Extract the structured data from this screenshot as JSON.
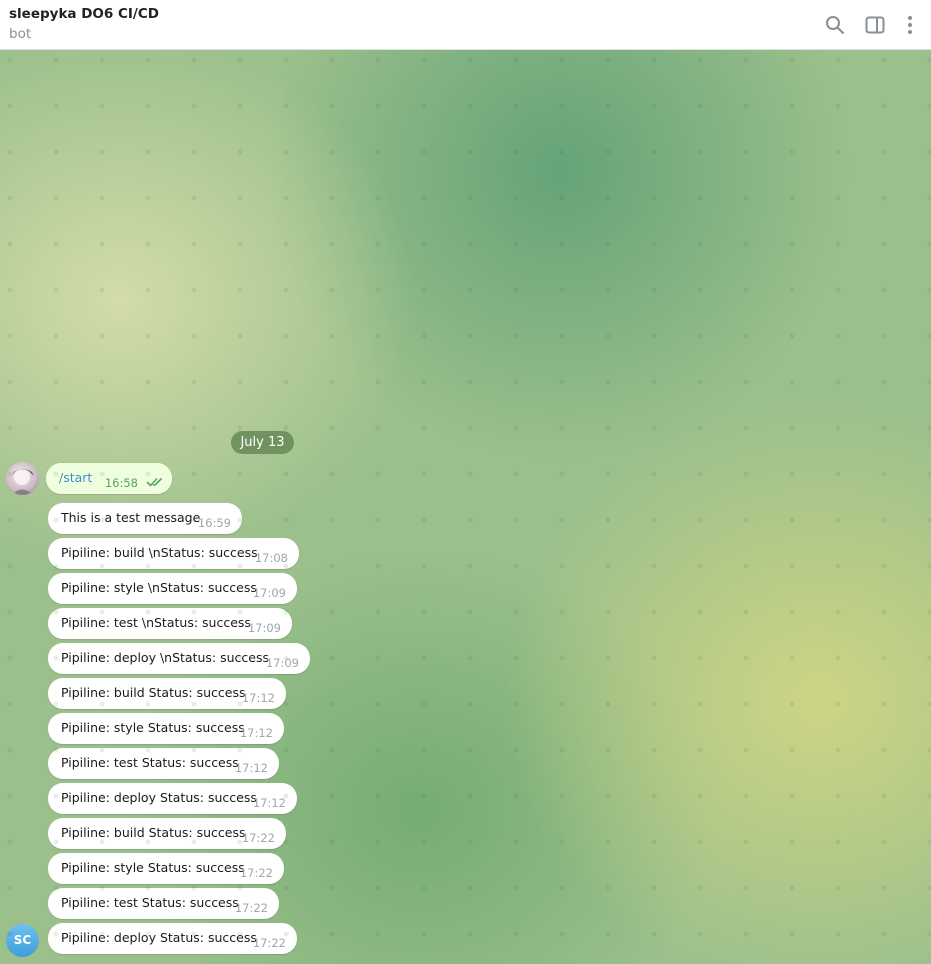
{
  "header": {
    "title": "sleepyka DO6 CI/CD",
    "subtitle": "bot",
    "icons": [
      "search-icon",
      "sidebar-toggle-icon",
      "more-vert-icon"
    ]
  },
  "chat": {
    "date_separator": "July 13",
    "sc_avatar_initials": "SC",
    "outgoing": {
      "text": "/start",
      "time": "16:58",
      "status_icon": "double-check-icon"
    },
    "incoming": [
      {
        "text": "This is a test message",
        "time": "16:59"
      },
      {
        "text": "Pipiline: build \\nStatus: success",
        "time": "17:08"
      },
      {
        "text": "Pipiline: style \\nStatus: success",
        "time": "17:09"
      },
      {
        "text": "Pipiline: test \\nStatus: success",
        "time": "17:09"
      },
      {
        "text": "Pipiline: deploy \\nStatus: success",
        "time": "17:09"
      },
      {
        "text": "Pipiline: build Status: success",
        "time": "17:12"
      },
      {
        "text": "Pipiline: style Status: success",
        "time": "17:12"
      },
      {
        "text": "Pipiline: test Status: success",
        "time": "17:12"
      },
      {
        "text": "Pipiline: deploy Status: success",
        "time": "17:12"
      },
      {
        "text": "Pipiline: build Status: success",
        "time": "17:22"
      },
      {
        "text": "Pipiline: style Status: success",
        "time": "17:22"
      },
      {
        "text": "Pipiline: test Status: success",
        "time": "17:22"
      },
      {
        "text": "Pipiline: deploy Status: success",
        "time": "17:22"
      }
    ]
  },
  "colors": {
    "outgoing_bubble": "#eefedf",
    "incoming_bubble": "#ffffff",
    "accent_link": "#3f8fcf",
    "read_check": "#57a75a",
    "avatar_sc": "#3d9fd9"
  }
}
